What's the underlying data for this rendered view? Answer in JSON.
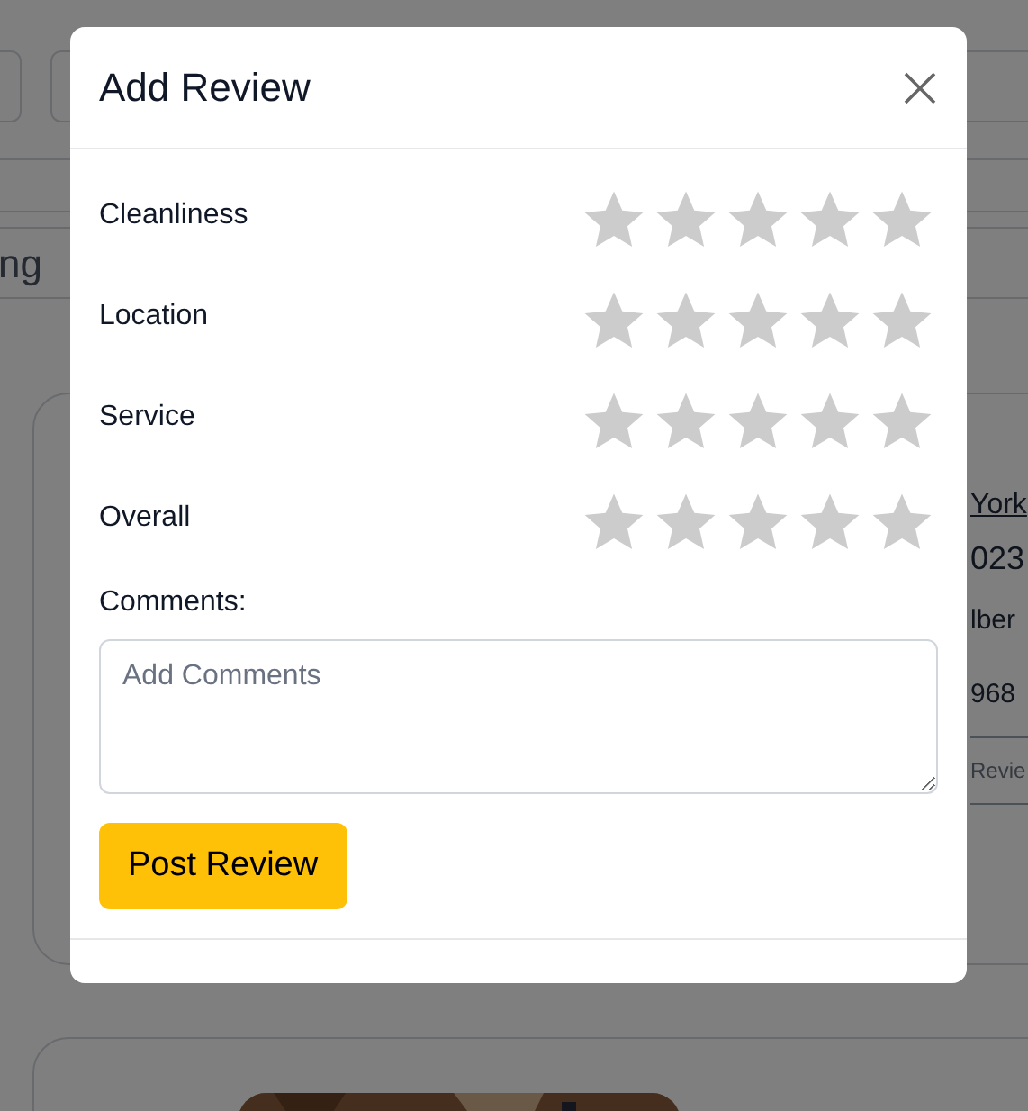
{
  "background": {
    "search_text": "ng",
    "card": {
      "title": "York",
      "line_2": "023",
      "line_3": "lber",
      "line_4": "968",
      "button": "Revie"
    }
  },
  "modal": {
    "title": "Add Review",
    "ratings": [
      {
        "label": "Cleanliness",
        "stars": 0
      },
      {
        "label": "Location",
        "stars": 0
      },
      {
        "label": "Service",
        "stars": 0
      },
      {
        "label": "Overall",
        "stars": 0
      }
    ],
    "comments_label": "Comments:",
    "comments": {
      "placeholder": "Add Comments"
    },
    "submit": "Post Review"
  }
}
